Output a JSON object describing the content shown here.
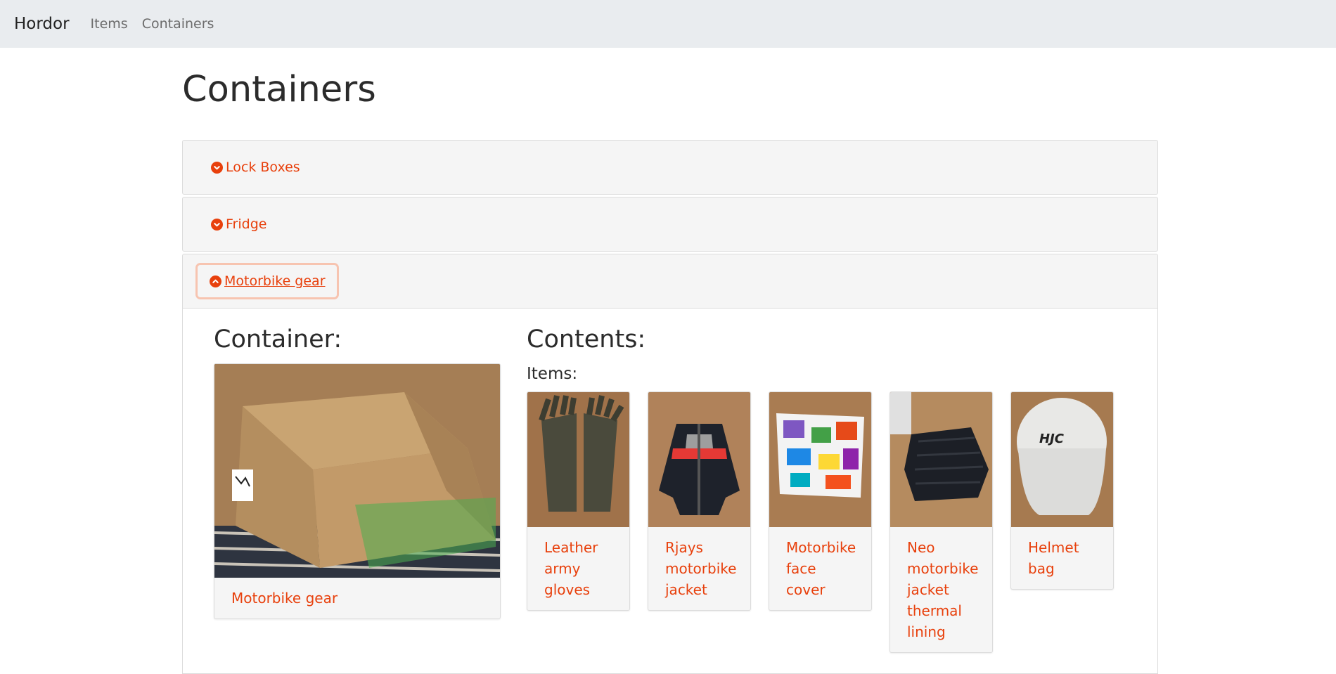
{
  "navbar": {
    "brand": "Hordor",
    "links": [
      {
        "label": "Items"
      },
      {
        "label": "Containers"
      }
    ]
  },
  "page": {
    "title": "Containers"
  },
  "accordion": {
    "sections": [
      {
        "label": "Lock Boxes",
        "state": "collapsed",
        "icon": "chevron-circle-down-icon"
      },
      {
        "label": "Fridge",
        "state": "collapsed",
        "icon": "chevron-circle-down-icon"
      },
      {
        "label": "Motorbike gear",
        "state": "expanded",
        "icon": "chevron-circle-up-icon"
      }
    ]
  },
  "expanded": {
    "container_heading": "Container:",
    "container_card": {
      "label": "Motorbike gear",
      "image": "cardboard-box-photo"
    },
    "contents_heading": "Contents:",
    "items_label": "Items:",
    "items": [
      {
        "label": "Leather army gloves",
        "image": "gloves-photo"
      },
      {
        "label": "Rjays motorbike jacket",
        "image": "jacket-photo"
      },
      {
        "label": "Motorbike face cover",
        "image": "face-cover-photo"
      },
      {
        "label": "Neo motorbike jacket thermal lining",
        "image": "thermal-lining-photo"
      },
      {
        "label": "Helmet bag",
        "image": "helmet-bag-photo"
      }
    ]
  },
  "colors": {
    "accent": "#e8400c",
    "navbar_bg": "#e9ecef",
    "card_bg": "#f5f5f5"
  }
}
